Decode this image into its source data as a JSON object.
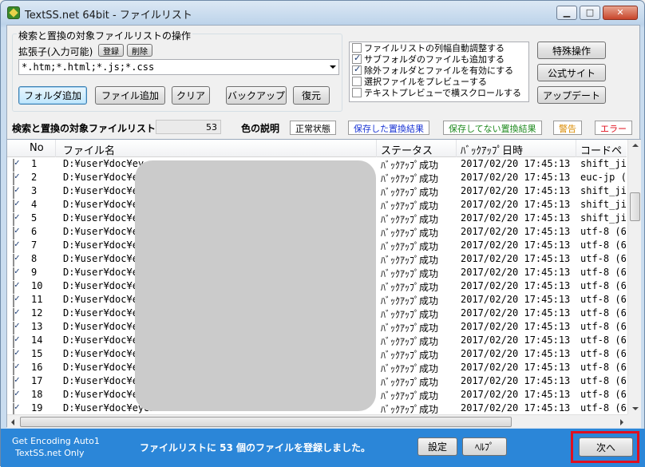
{
  "window": {
    "title": "TextSS.net 64bit - ファイルリスト",
    "minimize_glyph": "▁",
    "maximize_glyph": "□",
    "close_glyph": "✕"
  },
  "target_ops": {
    "group_title": "検索と置換の対象ファイルリストの操作",
    "ext_label": "拡張子(入力可能)",
    "register_label": "登録",
    "delete_label": "削除",
    "ext_value": "*.htm;*.html;*.js;*.css",
    "add_folder_label": "フォルダ追加",
    "add_file_label": "ファイル追加",
    "clear_label": "クリア",
    "backup_label": "バックアップ",
    "restore_label": "復元"
  },
  "options": [
    {
      "label": "ファイルリストの列幅自動調整する",
      "checked": false
    },
    {
      "label": "サブフォルダのファイルも追加する",
      "checked": true
    },
    {
      "label": "除外フォルダとファイルを有効にする",
      "checked": true
    },
    {
      "label": "選択ファイルをプレビューする",
      "checked": false
    },
    {
      "label": "テキストプレビューで横スクロールする",
      "checked": false
    }
  ],
  "side_buttons": {
    "special_label": "特殊操作",
    "official_label": "公式サイト",
    "update_label": "アップデート"
  },
  "summary": {
    "count_title": "検索と置換の対象ファイルリスト",
    "count_value": "53",
    "color_title": "色の説明"
  },
  "legend": [
    {
      "label": "正常状態",
      "color": "#000000"
    },
    {
      "label": "保存した置換結果",
      "color": "#1a35d4"
    },
    {
      "label": "保存してない置換結果",
      "color": "#1f8a1f"
    },
    {
      "label": "警告",
      "color": "#d98a00"
    },
    {
      "label": "エラー",
      "color": "#e0101e"
    }
  ],
  "grid": {
    "headers": {
      "no": "No",
      "file": "ファイル名",
      "status": "ステータス",
      "backup_time": "ﾊﾞｯｸｱｯﾌﾟ日時",
      "encoding": "コードペ"
    },
    "rows": [
      {
        "no": "1",
        "file": "D:¥user¥doc¥ey",
        "status": "ﾊﾞｯｸｱｯﾌﾟ成功",
        "time": "2017/02/20 17:45:13",
        "enc": "shift_ji"
      },
      {
        "no": "2",
        "file": "D:¥user¥doc¥e",
        "status": "ﾊﾞｯｸｱｯﾌﾟ成功",
        "time": "2017/02/20 17:45:13",
        "enc": "euc-jp ("
      },
      {
        "no": "3",
        "file": "D:¥user¥doc¥e",
        "status": "ﾊﾞｯｸｱｯﾌﾟ成功",
        "time": "2017/02/20 17:45:13",
        "enc": "shift_ji"
      },
      {
        "no": "4",
        "file": "D:¥user¥doc¥e",
        "status": "ﾊﾞｯｸｱｯﾌﾟ成功",
        "time": "2017/02/20 17:45:13",
        "enc": "shift_ji"
      },
      {
        "no": "5",
        "file": "D:¥user¥doc¥e",
        "status": "ﾊﾞｯｸｱｯﾌﾟ成功",
        "time": "2017/02/20 17:45:13",
        "enc": "shift_ji"
      },
      {
        "no": "6",
        "file": "D:¥user¥doc¥e",
        "status": "ﾊﾞｯｸｱｯﾌﾟ成功",
        "time": "2017/02/20 17:45:13",
        "enc": "utf-8 (6"
      },
      {
        "no": "7",
        "file": "D:¥user¥doc¥e",
        "status": "ﾊﾞｯｸｱｯﾌﾟ成功",
        "time": "2017/02/20 17:45:13",
        "enc": "utf-8 (6"
      },
      {
        "no": "8",
        "file": "D:¥user¥doc¥e",
        "status": "ﾊﾞｯｸｱｯﾌﾟ成功",
        "time": "2017/02/20 17:45:13",
        "enc": "utf-8 (6"
      },
      {
        "no": "9",
        "file": "D:¥user¥doc¥e",
        "status": "ﾊﾞｯｸｱｯﾌﾟ成功",
        "time": "2017/02/20 17:45:13",
        "enc": "utf-8 (6"
      },
      {
        "no": "10",
        "file": "D:¥user¥doc¥e",
        "status": "ﾊﾞｯｸｱｯﾌﾟ成功",
        "time": "2017/02/20 17:45:13",
        "enc": "utf-8 (6"
      },
      {
        "no": "11",
        "file": "D:¥user¥doc¥e",
        "status": "ﾊﾞｯｸｱｯﾌﾟ成功",
        "time": "2017/02/20 17:45:13",
        "enc": "utf-8 (6"
      },
      {
        "no": "12",
        "file": "D:¥user¥doc¥e",
        "status": "ﾊﾞｯｸｱｯﾌﾟ成功",
        "time": "2017/02/20 17:45:13",
        "enc": "utf-8 (6"
      },
      {
        "no": "13",
        "file": "D:¥user¥doc¥e",
        "status": "ﾊﾞｯｸｱｯﾌﾟ成功",
        "time": "2017/02/20 17:45:13",
        "enc": "utf-8 (6"
      },
      {
        "no": "14",
        "file": "D:¥user¥doc¥e",
        "status": "ﾊﾞｯｸｱｯﾌﾟ成功",
        "time": "2017/02/20 17:45:13",
        "enc": "utf-8 (6"
      },
      {
        "no": "15",
        "file": "D:¥user¥doc¥e",
        "status": "ﾊﾞｯｸｱｯﾌﾟ成功",
        "time": "2017/02/20 17:45:13",
        "enc": "utf-8 (6"
      },
      {
        "no": "16",
        "file": "D:¥user¥doc¥e",
        "status": "ﾊﾞｯｸｱｯﾌﾟ成功",
        "time": "2017/02/20 17:45:13",
        "enc": "utf-8 (6"
      },
      {
        "no": "17",
        "file": "D:¥user¥doc¥e",
        "status": "ﾊﾞｯｸｱｯﾌﾟ成功",
        "time": "2017/02/20 17:45:13",
        "enc": "utf-8 (6"
      },
      {
        "no": "18",
        "file": "D:¥user¥doc¥e",
        "status": "ﾊﾞｯｸｱｯﾌﾟ成功",
        "time": "2017/02/20 17:45:13",
        "enc": "utf-8 (6"
      },
      {
        "no": "19",
        "file": "D:¥user¥doc¥eyeb",
        "status": "ﾊﾞｯｸｱｯﾌﾟ成功",
        "time": "2017/02/20 17:45:13",
        "enc": "utf-8 (6"
      }
    ]
  },
  "status": {
    "encoding_line1": "Get Encoding Auto1",
    "encoding_line2": "TextSS.net Only",
    "message": "ファイルリストに 53 個のファイルを登録しました。",
    "settings_label": "設定",
    "help_label": "ﾍﾙﾌﾟ",
    "next_label": "次へ",
    "highlight_color": "#e00f1f"
  }
}
